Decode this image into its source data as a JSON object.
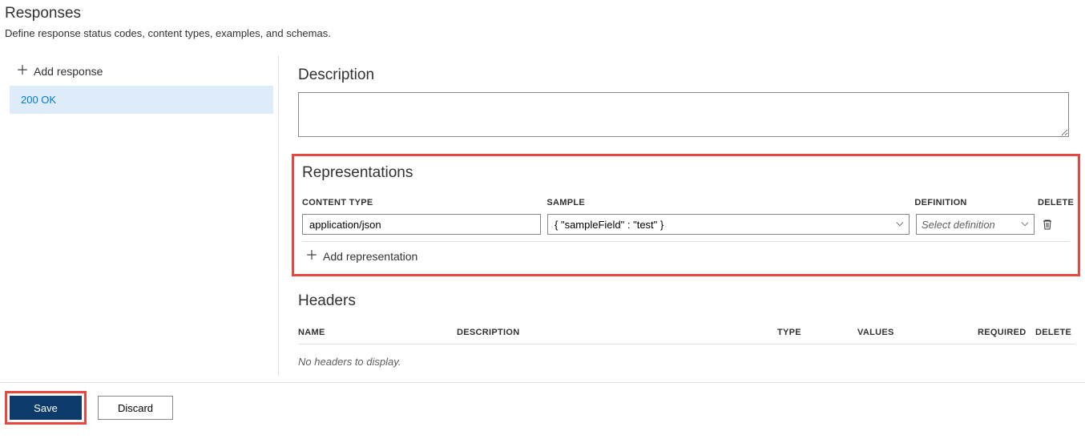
{
  "header": {
    "title": "Responses",
    "subtitle": "Define response status codes, content types, examples, and schemas."
  },
  "sidebar": {
    "add_response_label": "Add response",
    "responses": [
      {
        "label": "200 OK",
        "selected": true
      }
    ]
  },
  "description": {
    "heading": "Description",
    "value": ""
  },
  "representations": {
    "heading": "Representations",
    "columns": {
      "content_type": "CONTENT TYPE",
      "sample": "SAMPLE",
      "definition": "DEFINITION",
      "delete": "DELETE"
    },
    "rows": [
      {
        "content_type": "application/json",
        "sample": "{ \"sampleField\" : \"test\" }",
        "definition_placeholder": "Select definition"
      }
    ],
    "add_representation_label": "Add representation"
  },
  "headers": {
    "heading": "Headers",
    "columns": {
      "name": "NAME",
      "description": "DESCRIPTION",
      "type": "TYPE",
      "values": "VALUES",
      "required": "REQUIRED",
      "delete": "DELETE"
    },
    "empty_message": "No headers to display."
  },
  "footer": {
    "save_label": "Save",
    "discard_label": "Discard"
  }
}
